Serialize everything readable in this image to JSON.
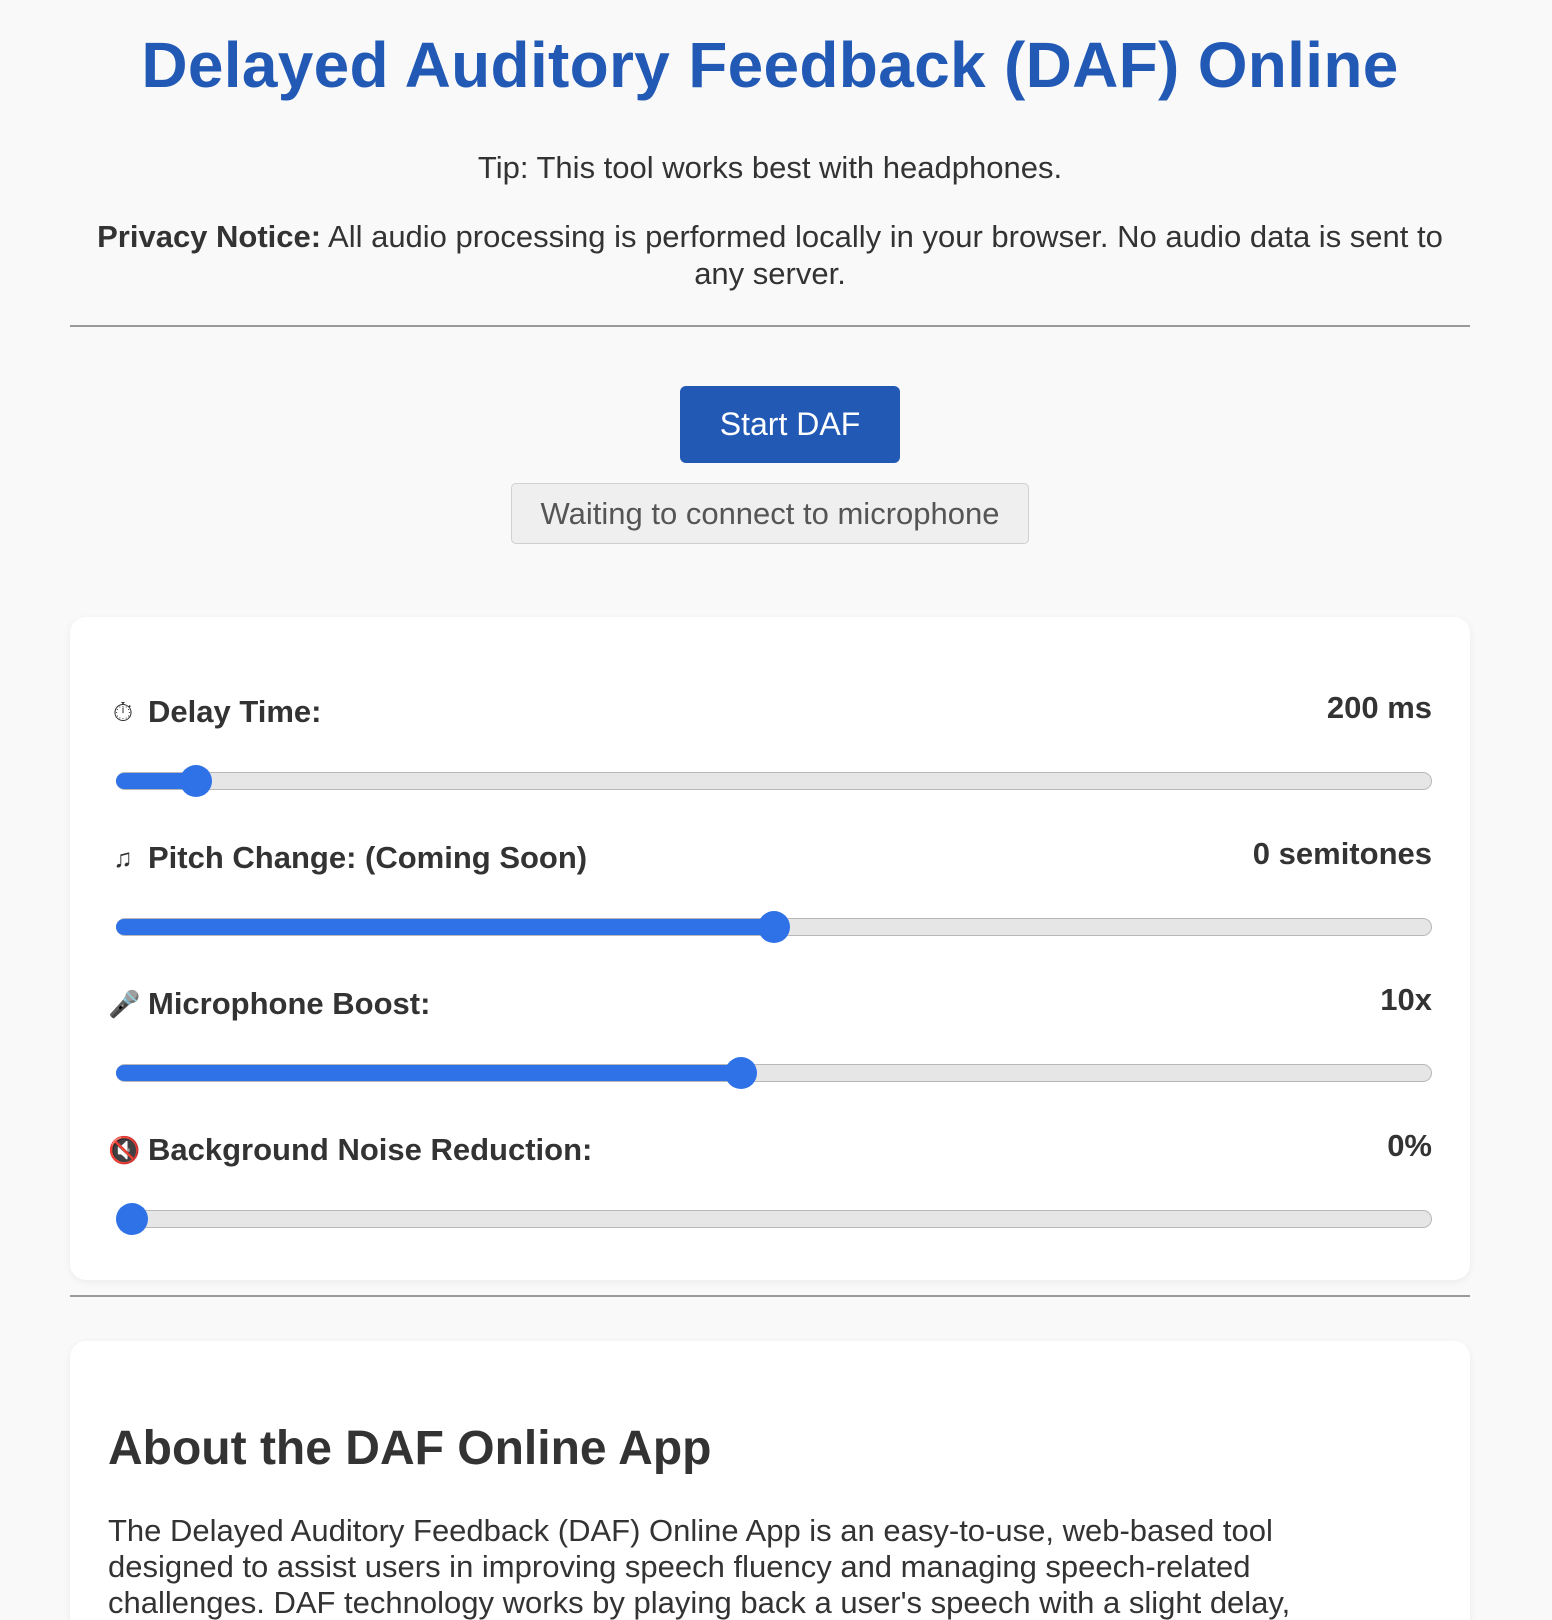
{
  "header": {
    "title": "Delayed Auditory Feedback (DAF) Online",
    "tip": "Tip: This tool works best with headphones.",
    "privacy_label": "Privacy Notice:",
    "privacy_text": " All audio processing is performed locally in your browser. No audio data is sent to any server."
  },
  "actions": {
    "start_label": "Start DAF",
    "status_text": "Waiting to connect to microphone"
  },
  "controls": [
    {
      "icon": "stopwatch-icon",
      "glyph": "⏱",
      "label": "Delay Time:",
      "value": "200 ms",
      "level": 0.05
    },
    {
      "icon": "music-note-icon",
      "glyph": "♫",
      "label": "Pitch Change: (Coming Soon)",
      "value": "0 semitones",
      "level": 0.5
    },
    {
      "icon": "microphone-icon",
      "glyph": "🎤",
      "label": "Microphone Boost:",
      "value": "10x",
      "level": 0.474
    },
    {
      "icon": "muted-speaker-icon",
      "glyph": "🔇",
      "label": "Background Noise Reduction:",
      "value": "0%",
      "level": 0.0
    }
  ],
  "about": {
    "title": "About the DAF Online App",
    "text": "The Delayed Auditory Feedback (DAF) Online App is an easy-to-use, web-based tool designed to assist users in improving speech fluency and managing speech-related challenges. DAF technology works by playing back a user's speech with a slight delay, which"
  },
  "colors": {
    "accent": "#2159b5",
    "slider": "#2f72e8",
    "background": "#f9f9f9"
  }
}
